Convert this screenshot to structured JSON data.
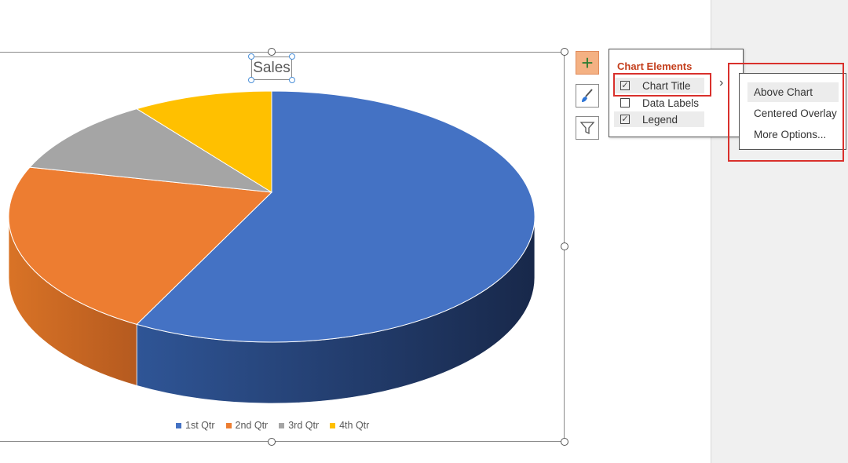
{
  "chart_data": {
    "type": "pie",
    "style": "3d",
    "title": "Sales",
    "categories": [
      "1st Qtr",
      "2nd Qtr",
      "3rd Qtr",
      "4th Qtr"
    ],
    "values": [
      8.2,
      3.2,
      1.4,
      1.2
    ],
    "colors": [
      "#4472c4",
      "#ed7d31",
      "#a5a5a5",
      "#ffc000"
    ],
    "side_colors": [
      "#2b4a86",
      "#b85f22",
      "#7a7a7a",
      "#c49300"
    ],
    "legend": {
      "position": "bottom",
      "entries": [
        "1st Qtr",
        "2nd Qtr",
        "3rd Qtr",
        "4th Qtr"
      ]
    }
  },
  "chart_elements_panel": {
    "title": "Chart Elements",
    "items": [
      {
        "label": "Chart Title",
        "checked": true,
        "check_glyph": "✓"
      },
      {
        "label": "Data Labels",
        "checked": false,
        "check_glyph": ""
      },
      {
        "label": "Legend",
        "checked": true,
        "check_glyph": "✓"
      }
    ],
    "arrow_glyph": "›"
  },
  "chart_title_submenu": {
    "items": [
      "Above Chart",
      "Centered Overlay",
      "More Options..."
    ]
  },
  "side_buttons": {
    "add_glyph": "+",
    "add_color": "#f4b183"
  }
}
